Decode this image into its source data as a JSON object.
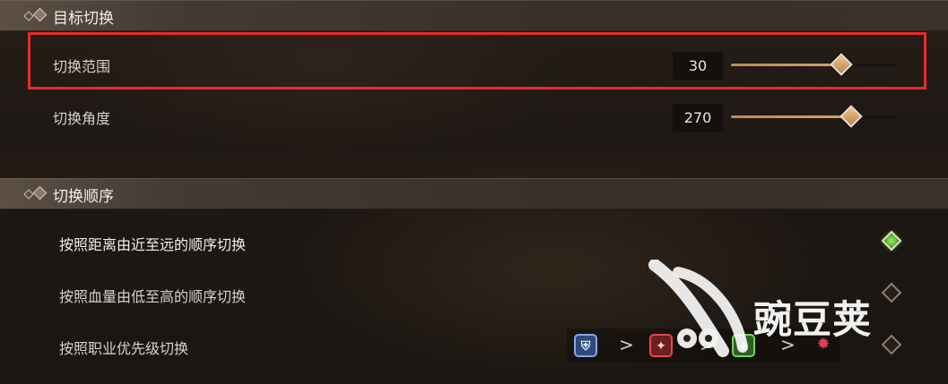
{
  "sections": [
    {
      "title": "目标切换",
      "items": [
        {
          "label": "切换范围",
          "value": "30",
          "progress": 0.66
        },
        {
          "label": "切换角度",
          "value": "270",
          "progress": 0.72
        }
      ]
    },
    {
      "title": "切换顺序",
      "options": [
        {
          "label": "按照距离由近至远的顺序切换",
          "selected": true
        },
        {
          "label": "按照血量由低至高的顺序切换",
          "selected": false
        },
        {
          "label": "按照职业优先级切换",
          "selected": false
        }
      ]
    }
  ],
  "priority": {
    "icons": [
      "shield-class-icon",
      "damage-class-icon",
      "heal-class-icon",
      "enemy-class-icon"
    ],
    "separator": ">"
  },
  "watermark": {
    "text": "豌豆荚"
  },
  "colors": {
    "highlight": "#ea2a2a",
    "selected": "#7fd04a",
    "slider_fill": "#c9965f"
  }
}
